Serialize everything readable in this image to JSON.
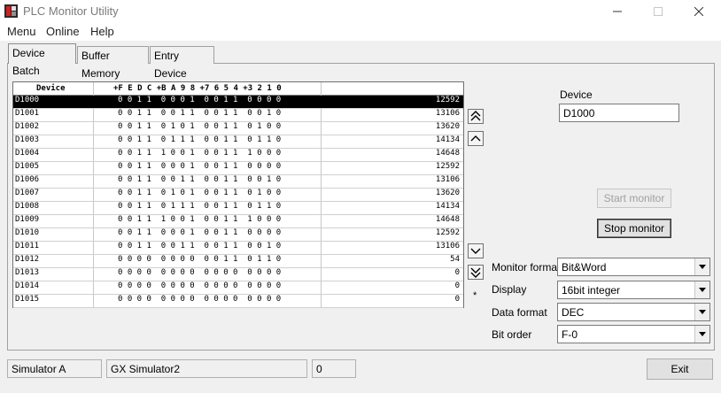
{
  "window": {
    "title": "PLC Monitor Utility"
  },
  "menu": [
    "Menu",
    "Online",
    "Help"
  ],
  "tabs": [
    "Device Batch",
    "Buffer Memory",
    "Entry Device"
  ],
  "grid": {
    "headers": {
      "device": "Device",
      "bits": "+F E D C +B A 9 8 +7 6 5 4 +3 2 1 0"
    },
    "rows": [
      {
        "device": "D1000",
        "bits": "0 0 1 1  0 0 0 1  0 0 1 1  0 0 0 0",
        "value": "12592"
      },
      {
        "device": "D1001",
        "bits": "0 0 1 1  0 0 1 1  0 0 1 1  0 0 1 0",
        "value": "13106"
      },
      {
        "device": "D1002",
        "bits": "0 0 1 1  0 1 0 1  0 0 1 1  0 1 0 0",
        "value": "13620"
      },
      {
        "device": "D1003",
        "bits": "0 0 1 1  0 1 1 1  0 0 1 1  0 1 1 0",
        "value": "14134"
      },
      {
        "device": "D1004",
        "bits": "0 0 1 1  1 0 0 1  0 0 1 1  1 0 0 0",
        "value": "14648"
      },
      {
        "device": "D1005",
        "bits": "0 0 1 1  0 0 0 1  0 0 1 1  0 0 0 0",
        "value": "12592"
      },
      {
        "device": "D1006",
        "bits": "0 0 1 1  0 0 1 1  0 0 1 1  0 0 1 0",
        "value": "13106"
      },
      {
        "device": "D1007",
        "bits": "0 0 1 1  0 1 0 1  0 0 1 1  0 1 0 0",
        "value": "13620"
      },
      {
        "device": "D1008",
        "bits": "0 0 1 1  0 1 1 1  0 0 1 1  0 1 1 0",
        "value": "14134"
      },
      {
        "device": "D1009",
        "bits": "0 0 1 1  1 0 0 1  0 0 1 1  1 0 0 0",
        "value": "14648"
      },
      {
        "device": "D1010",
        "bits": "0 0 1 1  0 0 0 1  0 0 1 1  0 0 0 0",
        "value": "12592"
      },
      {
        "device": "D1011",
        "bits": "0 0 1 1  0 0 1 1  0 0 1 1  0 0 1 0",
        "value": "13106"
      },
      {
        "device": "D1012",
        "bits": "0 0 0 0  0 0 0 0  0 0 1 1  0 1 1 0",
        "value": "54"
      },
      {
        "device": "D1013",
        "bits": "0 0 0 0  0 0 0 0  0 0 0 0  0 0 0 0",
        "value": "0"
      },
      {
        "device": "D1014",
        "bits": "0 0 0 0  0 0 0 0  0 0 0 0  0 0 0 0",
        "value": "0"
      },
      {
        "device": "D1015",
        "bits": "0 0 0 0  0 0 0 0  0 0 0 0  0 0 0 0",
        "value": "0"
      }
    ]
  },
  "asterisk": "*",
  "device": {
    "label": "Device",
    "value": "D1000"
  },
  "buttons": {
    "start": "Start monitor",
    "stop": "Stop monitor",
    "exit": "Exit"
  },
  "settings": [
    {
      "label": "Monitor format",
      "value": "Bit&Word"
    },
    {
      "label": "Display",
      "value": "16bit integer"
    },
    {
      "label": "Data format",
      "value": "DEC"
    },
    {
      "label": "Bit order",
      "value": "F-0"
    }
  ],
  "status": {
    "plc": "Simulator A",
    "sim": "GX Simulator2",
    "count": "0"
  }
}
